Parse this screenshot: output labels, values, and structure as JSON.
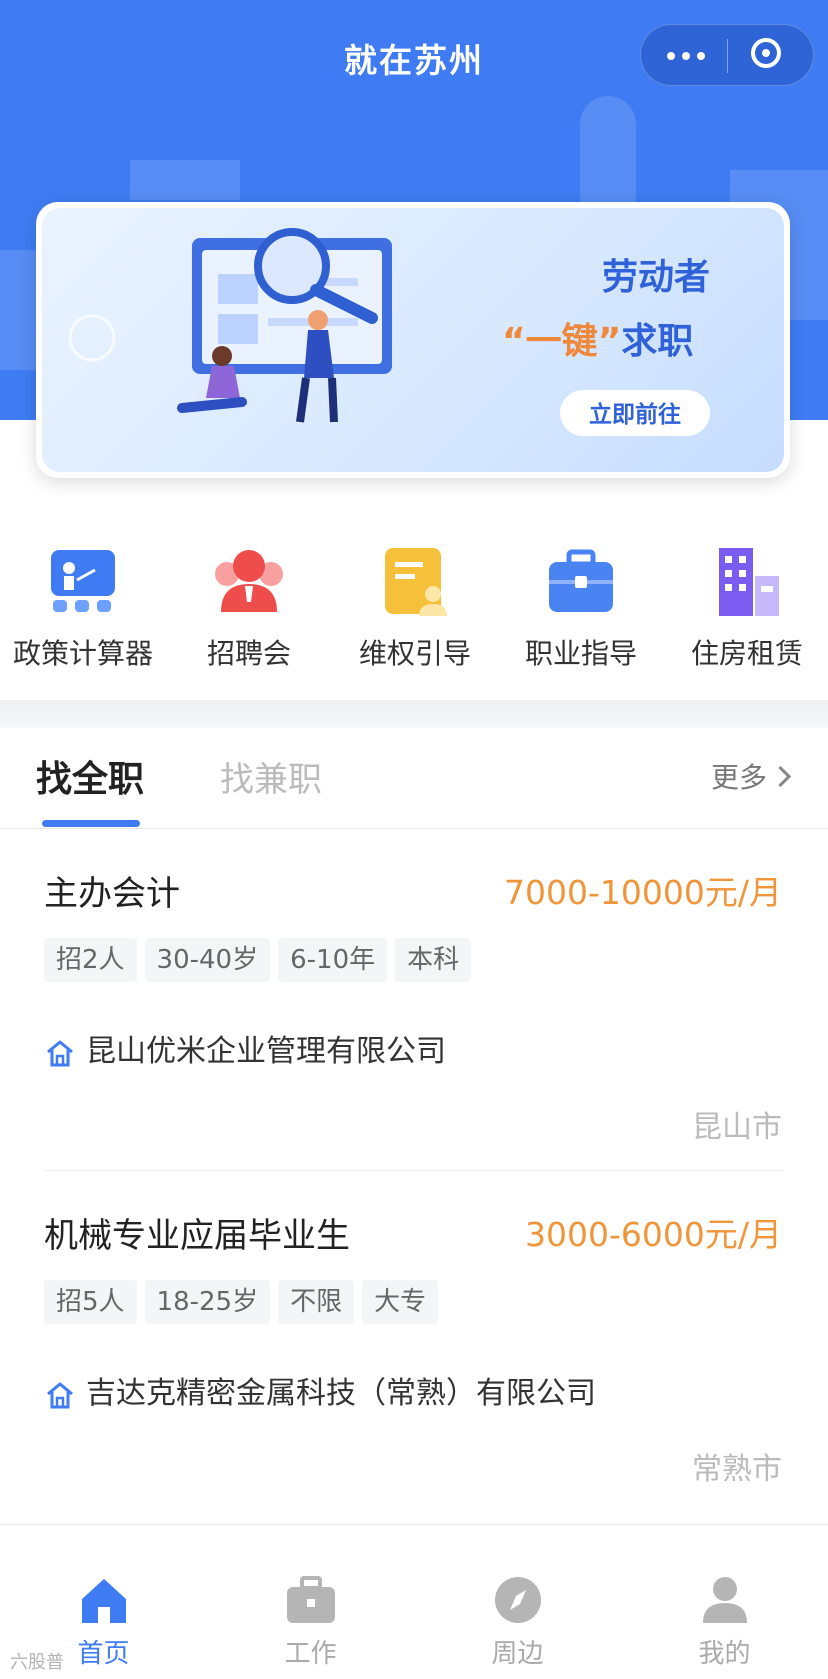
{
  "header": {
    "title": "就在苏州",
    "menu_icon": "more-dots-icon",
    "close_icon": "target-icon"
  },
  "banner": {
    "line1": "劳动者",
    "line2_highlight": "“一键”",
    "line2_rest": "求职",
    "button": "立即前往"
  },
  "services": [
    {
      "label": "政策计算器",
      "icon": "policy-calculator-icon",
      "color": "#3f7cf3"
    },
    {
      "label": "招聘会",
      "icon": "job-fair-icon",
      "color": "#ef4c4c"
    },
    {
      "label": "维权引导",
      "icon": "rights-guide-icon",
      "color": "#f6c03a"
    },
    {
      "label": "职业指导",
      "icon": "briefcase-icon",
      "color": "#4a84f2"
    },
    {
      "label": "住房租赁",
      "icon": "building-icon",
      "color": "#7b5cf0"
    }
  ],
  "tabs": {
    "full_time": "找全职",
    "part_time": "找兼职",
    "more": "更多"
  },
  "jobs": [
    {
      "title": "主办会计",
      "salary": "7000-10000元/月",
      "tags": [
        "招2人",
        "30-40岁",
        "6-10年",
        "本科"
      ],
      "company": "昆山优米企业管理有限公司",
      "city": "昆山市"
    },
    {
      "title": "机械专业应届毕业生",
      "salary": "3000-6000元/月",
      "tags": [
        "招5人",
        "18-25岁",
        "不限",
        "大专"
      ],
      "company": "吉达克精密金属科技（常熟）有限公司",
      "city": "常熟市"
    }
  ],
  "tabbar": [
    {
      "label": "首页",
      "icon": "home-icon",
      "active": true
    },
    {
      "label": "工作",
      "icon": "briefcase-icon",
      "active": false
    },
    {
      "label": "周边",
      "icon": "compass-icon",
      "active": false
    },
    {
      "label": "我的",
      "icon": "user-icon",
      "active": false
    }
  ],
  "watermark": "六股普",
  "colors": {
    "primary": "#3f7cf3",
    "salary": "#f0953a",
    "muted": "#bbbbbb"
  }
}
